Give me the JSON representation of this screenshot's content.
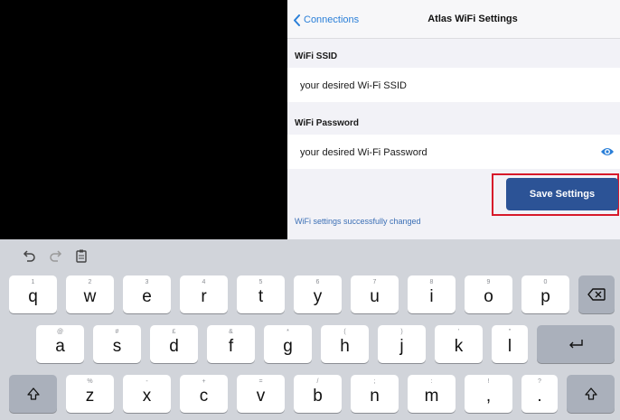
{
  "nav": {
    "back_label": "Connections",
    "title": "Atlas WiFi Settings"
  },
  "form": {
    "ssid_label": "WiFi SSID",
    "ssid_placeholder": "your desired Wi-Fi SSID",
    "password_label": "WiFi Password",
    "password_placeholder": "your desired Wi-Fi Password",
    "save_label": "Save Settings",
    "status_message": "WiFi settings successfully changed"
  },
  "keyboard": {
    "row1": [
      {
        "hint": "1",
        "main": "q"
      },
      {
        "hint": "2",
        "main": "w"
      },
      {
        "hint": "3",
        "main": "e"
      },
      {
        "hint": "4",
        "main": "r"
      },
      {
        "hint": "5",
        "main": "t"
      },
      {
        "hint": "6",
        "main": "y"
      },
      {
        "hint": "7",
        "main": "u"
      },
      {
        "hint": "8",
        "main": "i"
      },
      {
        "hint": "9",
        "main": "o"
      },
      {
        "hint": "0",
        "main": "p"
      }
    ],
    "row2": [
      {
        "hint": "@",
        "main": "a"
      },
      {
        "hint": "#",
        "main": "s"
      },
      {
        "hint": "£",
        "main": "d"
      },
      {
        "hint": "&",
        "main": "f"
      },
      {
        "hint": "*",
        "main": "g"
      },
      {
        "hint": "(",
        "main": "h"
      },
      {
        "hint": ")",
        "main": "j"
      },
      {
        "hint": "'",
        "main": "k"
      },
      {
        "hint": "\"",
        "main": "l"
      }
    ],
    "row3": [
      {
        "hint": "%",
        "main": "z"
      },
      {
        "hint": "-",
        "main": "x"
      },
      {
        "hint": "+",
        "main": "c"
      },
      {
        "hint": "=",
        "main": "v"
      },
      {
        "hint": "/",
        "main": "b"
      },
      {
        "hint": ";",
        "main": "n"
      },
      {
        "hint": ":",
        "main": "m"
      },
      {
        "hint": "!",
        "main": ","
      },
      {
        "hint": "?",
        "main": "."
      }
    ]
  },
  "icons": {
    "back": "chevron-left-icon",
    "eye": "eye-icon",
    "undo": "undo-icon",
    "redo": "redo-icon",
    "paste": "paste-icon",
    "delete": "backspace-icon",
    "return": "return-icon",
    "shift": "shift-icon"
  },
  "colors": {
    "accent": "#2a7fd8",
    "button": "#2c5396",
    "highlight": "#d7192a",
    "status": "#3b6fb5"
  }
}
